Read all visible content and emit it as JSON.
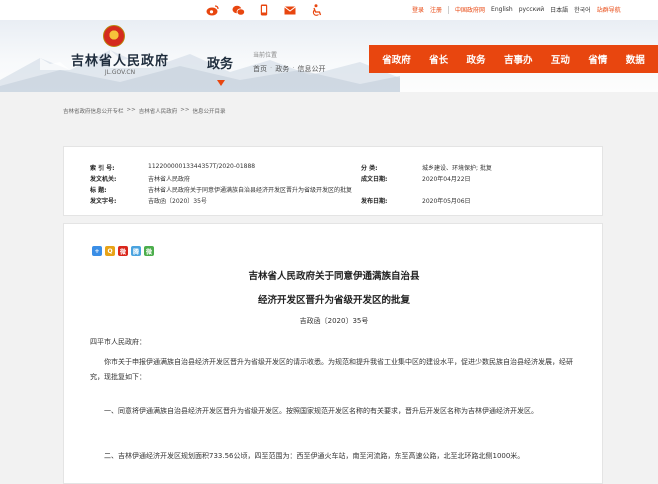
{
  "top_bar": {
    "icons": [
      "weibo-icon",
      "wechat-icon",
      "mobile-icon",
      "mail-icon",
      "accessibility-icon"
    ],
    "links": [
      {
        "label": "登录",
        "red": true
      },
      {
        "label": "注册",
        "red": true
      },
      {
        "label": "中国政府网",
        "red": true
      },
      {
        "label": "English",
        "red": false
      },
      {
        "label": "русский",
        "red": false
      },
      {
        "label": "日本語",
        "red": false
      },
      {
        "label": "한국어",
        "red": false
      },
      {
        "label": "站群导航",
        "red": true
      }
    ]
  },
  "header": {
    "site_name": "吉林省人民政府",
    "site_domain": "JL.GOV.CN",
    "section_title": "政务",
    "location_label": "当前位置",
    "location_path": [
      "首页",
      "政务",
      "信息公开"
    ]
  },
  "main_nav": [
    "省政府",
    "省长",
    "政务",
    "吉事办",
    "互动",
    "省情",
    "数据"
  ],
  "breadcrumb": [
    "吉林省政府信息公开专栏",
    "吉林省人民政府",
    "信息公开目录"
  ],
  "meta": {
    "index_label": "索 引 号:",
    "index_value": "11220000013344357T/2020-01888",
    "category_label": "分      类:",
    "category_value": "城乡建设、环境保护; 批复",
    "issuer_label": "发文机关:",
    "issuer_value": "吉林省人民政府",
    "date_label": "成文日期:",
    "date_value": "2020年04月22日",
    "title_label": "标      题:",
    "title_value": "吉林省人民政府关于同意伊通满族自治县经济开发区晋升为省级开发区的批复",
    "docno_label": "发文字号:",
    "docno_value": "吉政函〔2020〕35号",
    "pubdate_label": "发布日期:",
    "pubdate_value": "2020年05月06日"
  },
  "share": {
    "colors": [
      "#3a8ee6",
      "#e8a317",
      "#d9261c",
      "#4aa3df",
      "#4cae4c"
    ],
    "glyphs": [
      "+",
      "Q",
      "微",
      "腾",
      "微"
    ]
  },
  "article": {
    "title_line1": "吉林省人民政府关于同意伊通满族自治县",
    "title_line2": "经济开发区晋升为省级开发区的批复",
    "doc_number": "吉政函〔2020〕35号",
    "salutation": "四平市人民政府：",
    "p1": "你市关于申报伊通满族自治县经济开发区晋升为省级开发区的请示收悉。为规范和提升我省工业集中区的建设水平，促进少数民族自治县经济发展，经研究，现批复如下：",
    "p2": "一、同意将伊通满族自治县经济开发区晋升为省级开发区。按照国家规范开发区名称的有关要求，晋升后开发区名称为吉林伊通经济开发区。",
    "p3": "二、吉林伊通经济开发区规划面积733.56公顷，四至范围为：西至伊通火车站，南至河流路，东至高速公路，北至北环路北侧1000米。"
  }
}
